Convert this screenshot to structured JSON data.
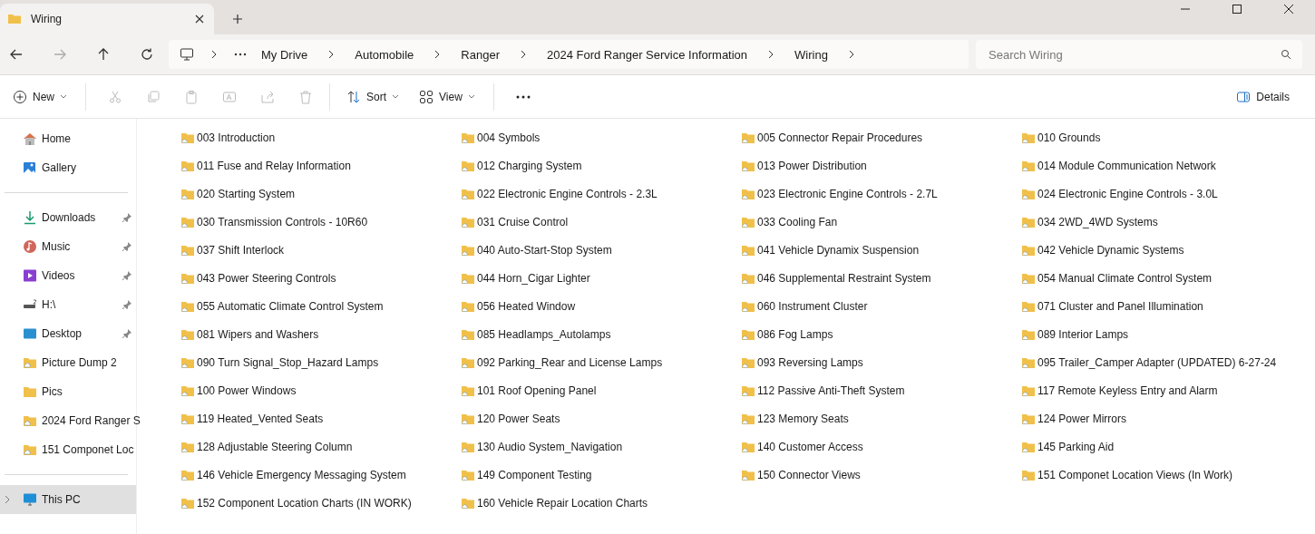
{
  "window": {
    "tab_title": "Wiring"
  },
  "breadcrumbs": [
    "My Drive",
    "Automobile",
    "Ranger",
    "2024 Ford Ranger Service Information",
    "Wiring"
  ],
  "search": {
    "placeholder": "Search Wiring"
  },
  "toolbar": {
    "new": "New",
    "sort": "Sort",
    "view": "View",
    "details": "Details"
  },
  "sidebar": {
    "top": [
      {
        "label": "Home",
        "kind": "home",
        "selected": false
      },
      {
        "label": "Gallery",
        "kind": "gallery",
        "selected": false
      }
    ],
    "quick_access": [
      {
        "label": "Downloads",
        "kind": "downloads",
        "pinned": true,
        "selected": false
      },
      {
        "label": "Music",
        "kind": "music",
        "pinned": true,
        "selected": false
      },
      {
        "label": "Videos",
        "kind": "videos",
        "pinned": true,
        "selected": false
      },
      {
        "label": "H:\\",
        "kind": "drive",
        "pinned": true,
        "selected": false
      },
      {
        "label": "Desktop",
        "kind": "desktop",
        "pinned": true,
        "selected": false
      },
      {
        "label": "Picture Dump 2",
        "kind": "cloud-folder",
        "pinned": false,
        "selected": false
      },
      {
        "label": "Pics",
        "kind": "folder",
        "pinned": false,
        "selected": false
      },
      {
        "label": "2024 Ford Ranger S",
        "kind": "cloud-folder",
        "pinned": false,
        "selected": false
      },
      {
        "label": "151 Componet Loc",
        "kind": "cloud-folder",
        "pinned": false,
        "selected": false
      }
    ],
    "devices": [
      {
        "label": "This PC",
        "kind": "pc",
        "selected": true
      }
    ]
  },
  "folders": [
    "003 Introduction",
    "004 Symbols",
    "005 Connector Repair Procedures",
    "010 Grounds",
    "011 Fuse and Relay Information",
    "012 Charging System",
    "013 Power Distribution",
    "014 Module Communication Network",
    "020 Starting System",
    "022 Electronic Engine Controls - 2.3L",
    "023 Electronic Engine Controls - 2.7L",
    "024 Electronic Engine Controls - 3.0L",
    "030 Transmission Controls - 10R60",
    "031 Cruise Control",
    "033 Cooling Fan",
    "034 2WD_4WD Systems",
    "037 Shift Interlock",
    "040 Auto-Start-Stop System",
    "041 Vehicle Dynamix Suspension",
    "042 Vehicle Dynamic Systems",
    "043 Power Steering Controls",
    "044 Horn_Cigar Lighter",
    "046 Supplemental Restraint System",
    "054 Manual Climate Control System",
    "055 Automatic Climate Control System",
    "056 Heated Window",
    "060 Instrument Cluster",
    "071 Cluster and Panel Illumination",
    "081 Wipers and Washers",
    "085 Headlamps_Autolamps",
    "086 Fog Lamps",
    "089 Interior Lamps",
    "090 Turn Signal_Stop_Hazard Lamps",
    "092 Parking_Rear and License Lamps",
    "093 Reversing Lamps",
    "095 Trailer_Camper Adapter (UPDATED) 6-27-24",
    "100 Power Windows",
    "101 Roof Opening Panel",
    "112 Passive Anti-Theft System",
    "117 Remote Keyless Entry and Alarm",
    "119 Heated_Vented Seats",
    "120 Power Seats",
    "123 Memory Seats",
    "124 Power Mirrors",
    "128 Adjustable Steering Column",
    "130 Audio System_Navigation",
    "140 Customer Access",
    "145 Parking Aid",
    "146 Vehicle Emergency Messaging System",
    "149 Component Testing",
    "150 Connector Views",
    "151 Componet Location Views (In Work)",
    "152 Component Location Charts (IN WORK)",
    "160 Vehicle Repair Location Charts"
  ]
}
